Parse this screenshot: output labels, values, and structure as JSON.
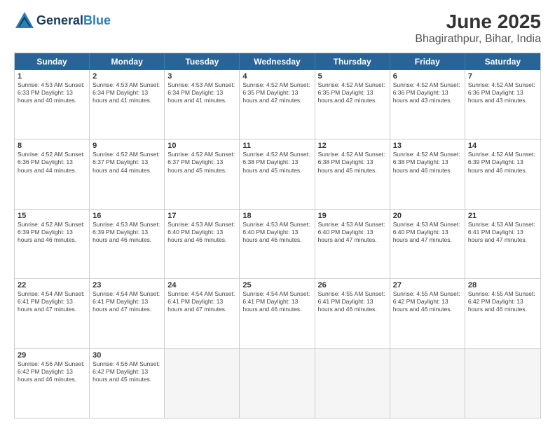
{
  "logo": {
    "line1": "General",
    "line2": "Blue"
  },
  "title": "June 2025",
  "subtitle": "Bhagirathpur, Bihar, India",
  "headers": [
    "Sunday",
    "Monday",
    "Tuesday",
    "Wednesday",
    "Thursday",
    "Friday",
    "Saturday"
  ],
  "rows": [
    [
      {
        "day": "1",
        "text": "Sunrise: 4:53 AM\nSunset: 6:33 PM\nDaylight: 13 hours\nand 40 minutes."
      },
      {
        "day": "2",
        "text": "Sunrise: 4:53 AM\nSunset: 6:34 PM\nDaylight: 13 hours\nand 41 minutes."
      },
      {
        "day": "3",
        "text": "Sunrise: 4:53 AM\nSunset: 6:34 PM\nDaylight: 13 hours\nand 41 minutes."
      },
      {
        "day": "4",
        "text": "Sunrise: 4:52 AM\nSunset: 6:35 PM\nDaylight: 13 hours\nand 42 minutes."
      },
      {
        "day": "5",
        "text": "Sunrise: 4:52 AM\nSunset: 6:35 PM\nDaylight: 13 hours\nand 42 minutes."
      },
      {
        "day": "6",
        "text": "Sunrise: 4:52 AM\nSunset: 6:36 PM\nDaylight: 13 hours\nand 43 minutes."
      },
      {
        "day": "7",
        "text": "Sunrise: 4:52 AM\nSunset: 6:36 PM\nDaylight: 13 hours\nand 43 minutes."
      }
    ],
    [
      {
        "day": "8",
        "text": "Sunrise: 4:52 AM\nSunset: 6:36 PM\nDaylight: 13 hours\nand 44 minutes."
      },
      {
        "day": "9",
        "text": "Sunrise: 4:52 AM\nSunset: 6:37 PM\nDaylight: 13 hours\nand 44 minutes."
      },
      {
        "day": "10",
        "text": "Sunrise: 4:52 AM\nSunset: 6:37 PM\nDaylight: 13 hours\nand 45 minutes."
      },
      {
        "day": "11",
        "text": "Sunrise: 4:52 AM\nSunset: 6:38 PM\nDaylight: 13 hours\nand 45 minutes."
      },
      {
        "day": "12",
        "text": "Sunrise: 4:52 AM\nSunset: 6:38 PM\nDaylight: 13 hours\nand 45 minutes."
      },
      {
        "day": "13",
        "text": "Sunrise: 4:52 AM\nSunset: 6:38 PM\nDaylight: 13 hours\nand 46 minutes."
      },
      {
        "day": "14",
        "text": "Sunrise: 4:52 AM\nSunset: 6:39 PM\nDaylight: 13 hours\nand 46 minutes."
      }
    ],
    [
      {
        "day": "15",
        "text": "Sunrise: 4:52 AM\nSunset: 6:39 PM\nDaylight: 13 hours\nand 46 minutes."
      },
      {
        "day": "16",
        "text": "Sunrise: 4:53 AM\nSunset: 6:39 PM\nDaylight: 13 hours\nand 46 minutes."
      },
      {
        "day": "17",
        "text": "Sunrise: 4:53 AM\nSunset: 6:40 PM\nDaylight: 13 hours\nand 46 minutes."
      },
      {
        "day": "18",
        "text": "Sunrise: 4:53 AM\nSunset: 6:40 PM\nDaylight: 13 hours\nand 46 minutes."
      },
      {
        "day": "19",
        "text": "Sunrise: 4:53 AM\nSunset: 6:40 PM\nDaylight: 13 hours\nand 47 minutes."
      },
      {
        "day": "20",
        "text": "Sunrise: 4:53 AM\nSunset: 6:40 PM\nDaylight: 13 hours\nand 47 minutes."
      },
      {
        "day": "21",
        "text": "Sunrise: 4:53 AM\nSunset: 6:41 PM\nDaylight: 13 hours\nand 47 minutes."
      }
    ],
    [
      {
        "day": "22",
        "text": "Sunrise: 4:54 AM\nSunset: 6:41 PM\nDaylight: 13 hours\nand 47 minutes."
      },
      {
        "day": "23",
        "text": "Sunrise: 4:54 AM\nSunset: 6:41 PM\nDaylight: 13 hours\nand 47 minutes."
      },
      {
        "day": "24",
        "text": "Sunrise: 4:54 AM\nSunset: 6:41 PM\nDaylight: 13 hours\nand 47 minutes."
      },
      {
        "day": "25",
        "text": "Sunrise: 4:54 AM\nSunset: 6:41 PM\nDaylight: 13 hours\nand 46 minutes."
      },
      {
        "day": "26",
        "text": "Sunrise: 4:55 AM\nSunset: 6:41 PM\nDaylight: 13 hours\nand 46 minutes."
      },
      {
        "day": "27",
        "text": "Sunrise: 4:55 AM\nSunset: 6:42 PM\nDaylight: 13 hours\nand 46 minutes."
      },
      {
        "day": "28",
        "text": "Sunrise: 4:55 AM\nSunset: 6:42 PM\nDaylight: 13 hours\nand 46 minutes."
      }
    ],
    [
      {
        "day": "29",
        "text": "Sunrise: 4:56 AM\nSunset: 6:42 PM\nDaylight: 13 hours\nand 46 minutes."
      },
      {
        "day": "30",
        "text": "Sunrise: 4:56 AM\nSunset: 6:42 PM\nDaylight: 13 hours\nand 45 minutes."
      },
      {
        "day": "",
        "text": "",
        "empty": true
      },
      {
        "day": "",
        "text": "",
        "empty": true
      },
      {
        "day": "",
        "text": "",
        "empty": true
      },
      {
        "day": "",
        "text": "",
        "empty": true
      },
      {
        "day": "",
        "text": "",
        "empty": true
      }
    ]
  ]
}
